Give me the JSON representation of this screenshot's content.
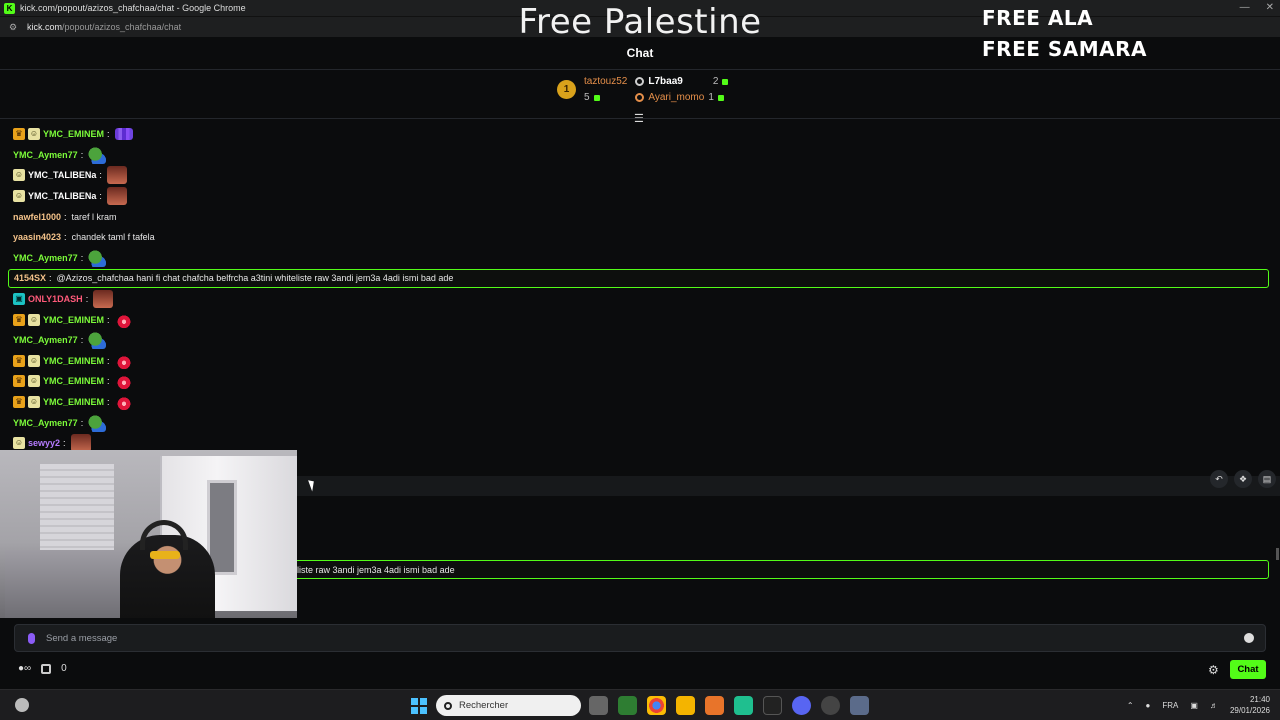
{
  "browser": {
    "tab_title": "kick.com/popout/azizos_chafchaa/chat - Google Chrome",
    "url_domain": "kick.com",
    "url_path": "/popout/azizos_chafchaa/chat"
  },
  "overlay": {
    "center_text": "Free Palestine",
    "right_line1": "FREE ALA",
    "right_line2": "FREE SAMARA"
  },
  "chat": {
    "header": "Chat",
    "leaderboard": {
      "first": {
        "rank": "1",
        "name": "taztouz52",
        "count": "5"
      },
      "second": {
        "name": "L7baa9",
        "count": "2"
      },
      "third": {
        "name": "Ayari_momo",
        "count": "1"
      }
    },
    "messages": [
      {
        "user": "YMC_EMINEM",
        "badges": [
          "crown",
          "sub"
        ],
        "color": "#7CFC3A",
        "text": "",
        "emote": "bars"
      },
      {
        "user": "YMC_Aymen77",
        "badges": [],
        "color": "#7CFC3A",
        "text": "",
        "emote": "frog"
      },
      {
        "user": "YMC_TALIBENa",
        "badges": [
          "sub"
        ],
        "color": "#ffffff",
        "text": "",
        "emote": "face"
      },
      {
        "user": "YMC_TALIBENa",
        "badges": [
          "sub"
        ],
        "color": "#ffffff",
        "text": "",
        "emote": "face"
      },
      {
        "user": "nawfel1000",
        "badges": [],
        "color": "#f4c38a",
        "text": "taref l kram",
        "emote": ""
      },
      {
        "user": "yaasin4023",
        "badges": [],
        "color": "#f4c38a",
        "text": "chandek taml f tafela",
        "emote": ""
      },
      {
        "user": "YMC_Aymen77",
        "badges": [],
        "color": "#7CFC3A",
        "text": "",
        "emote": "frog"
      },
      {
        "user": "4154SX",
        "badges": [],
        "color": "#f4c38a",
        "text": "@Azizos_chafchaa hani fi chat chafcha belfrcha a3tini whiteliste raw 3andi jem3a 4adi ismi bad ade",
        "emote": "",
        "highlight": true
      },
      {
        "user": "ONLY1DASH",
        "badges": [
          "cyan"
        ],
        "color": "#ff5a7a",
        "text": "",
        "emote": "face"
      },
      {
        "user": "YMC_EMINEM",
        "badges": [
          "crown",
          "sub"
        ],
        "color": "#7CFC3A",
        "text": "",
        "emote": "flame"
      },
      {
        "user": "YMC_Aymen77",
        "badges": [],
        "color": "#7CFC3A",
        "text": "",
        "emote": "frog"
      },
      {
        "user": "YMC_EMINEM",
        "badges": [
          "crown",
          "sub"
        ],
        "color": "#7CFC3A",
        "text": "",
        "emote": "flame"
      },
      {
        "user": "YMC_EMINEM",
        "badges": [
          "crown",
          "sub"
        ],
        "color": "#7CFC3A",
        "text": "",
        "emote": "flame"
      },
      {
        "user": "YMC_EMINEM",
        "badges": [
          "crown",
          "sub"
        ],
        "color": "#7CFC3A",
        "text": "",
        "emote": "flame"
      },
      {
        "user": "YMC_Aymen77",
        "badges": [],
        "color": "#7CFC3A",
        "text": "",
        "emote": "frog"
      },
      {
        "user": "sewyy2",
        "badges": [
          "sub"
        ],
        "color": "#b57bff",
        "text": "",
        "emote": "face"
      }
    ],
    "pinned_partial_text": "liste raw 3andi jem3a 4adi ismi bad ade",
    "input_placeholder": "Send a message",
    "gift_count": "0",
    "send_label": "Chat"
  },
  "taskbar": {
    "search_placeholder": "Rechercher",
    "language": "FRA",
    "time": "21:40",
    "date": "29/01/2026"
  },
  "colors": {
    "accent": "#53fc18",
    "background": "#0b0c0d"
  }
}
